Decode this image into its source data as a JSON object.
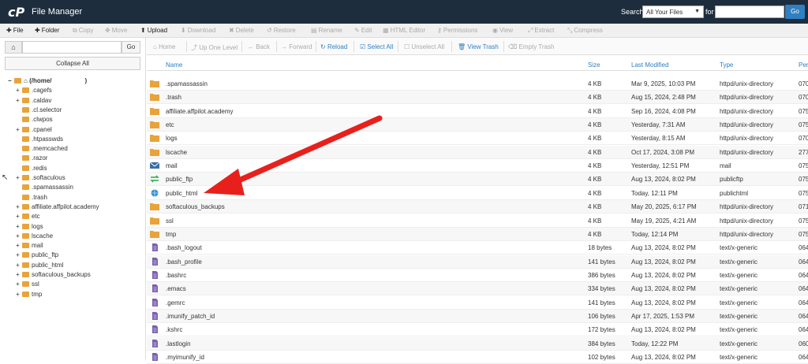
{
  "header": {
    "logo": "cP",
    "title": "File Manager",
    "search_label": "Search",
    "search_scope": "All Your Files",
    "for_label": "for",
    "go_label": "Go"
  },
  "toolbar": {
    "file": "File",
    "folder": "Folder",
    "copy": "Copy",
    "move": "Move",
    "upload": "Upload",
    "download": "Download",
    "delete": "Delete",
    "restore": "Restore",
    "rename": "Rename",
    "edit": "Edit",
    "html_editor": "HTML Editor",
    "permissions": "Permissions",
    "view": "View",
    "extract": "Extract",
    "compress": "Compress"
  },
  "left": {
    "go_label": "Go",
    "collapse_all": "Collapse All",
    "tree": [
      {
        "label": "(/home/",
        "suffix": ")",
        "pm": "−",
        "level": 0,
        "root": true
      },
      {
        "label": ".cagefs",
        "pm": "+",
        "level": 1
      },
      {
        "label": ".caldav",
        "pm": "+",
        "level": 1
      },
      {
        "label": ".cl.selector",
        "pm": "",
        "level": 1
      },
      {
        "label": ".clwpos",
        "pm": "",
        "level": 1
      },
      {
        "label": ".cpanel",
        "pm": "+",
        "level": 1
      },
      {
        "label": ".htpasswds",
        "pm": "",
        "level": 1
      },
      {
        "label": ".memcached",
        "pm": "",
        "level": 1
      },
      {
        "label": ".razor",
        "pm": "",
        "level": 1
      },
      {
        "label": ".redis",
        "pm": "",
        "level": 1
      },
      {
        "label": ".softaculous",
        "pm": "+",
        "level": 1
      },
      {
        "label": ".spamassassin",
        "pm": "",
        "level": 1
      },
      {
        "label": ".trash",
        "pm": "",
        "level": 1
      },
      {
        "label": "affiliate.affpilot.academy",
        "pm": "+",
        "level": 1
      },
      {
        "label": "etc",
        "pm": "+",
        "level": 1
      },
      {
        "label": "logs",
        "pm": "+",
        "level": 1
      },
      {
        "label": "lscache",
        "pm": "+",
        "level": 1
      },
      {
        "label": "mail",
        "pm": "+",
        "level": 1
      },
      {
        "label": "public_ftp",
        "pm": "+",
        "level": 1
      },
      {
        "label": "public_html",
        "pm": "+",
        "level": 1
      },
      {
        "label": "softaculous_backups",
        "pm": "+",
        "level": 1
      },
      {
        "label": "ssl",
        "pm": "+",
        "level": 1
      },
      {
        "label": "tmp",
        "pm": "+",
        "level": 1
      }
    ]
  },
  "right_toolbar": {
    "home": "Home",
    "up_one_level": "Up One Level",
    "back": "Back",
    "forward": "Forward",
    "reload": "Reload",
    "select_all": "Select All",
    "unselect_all": "Unselect All",
    "view_trash": "View Trash",
    "empty_trash": "Empty Trash"
  },
  "table": {
    "columns": {
      "name": "Name",
      "size": "Size",
      "modified": "Last Modified",
      "type": "Type",
      "perms": "Per"
    },
    "rows": [
      {
        "icon": "folder",
        "name": ".spamassassin",
        "size": "4 KB",
        "modified": "Mar 9, 2025, 10:03 PM",
        "type": "httpd/unix-directory",
        "perms": "070"
      },
      {
        "icon": "folder",
        "name": ".trash",
        "size": "4 KB",
        "modified": "Aug 15, 2024, 2:48 PM",
        "type": "httpd/unix-directory",
        "perms": "070"
      },
      {
        "icon": "folder",
        "name": "affiliate.affpilot.academy",
        "size": "4 KB",
        "modified": "Sep 16, 2024, 4:08 PM",
        "type": "httpd/unix-directory",
        "perms": "075"
      },
      {
        "icon": "folder",
        "name": "etc",
        "size": "4 KB",
        "modified": "Yesterday, 7:31 AM",
        "type": "httpd/unix-directory",
        "perms": "075"
      },
      {
        "icon": "folder",
        "name": "logs",
        "size": "4 KB",
        "modified": "Yesterday, 8:15 AM",
        "type": "httpd/unix-directory",
        "perms": "070"
      },
      {
        "icon": "folder",
        "name": "lscache",
        "size": "4 KB",
        "modified": "Oct 17, 2024, 3:08 PM",
        "type": "httpd/unix-directory",
        "perms": "277"
      },
      {
        "icon": "mail",
        "name": "mail",
        "size": "4 KB",
        "modified": "Yesterday, 12:51 PM",
        "type": "mail",
        "perms": "075"
      },
      {
        "icon": "ftp",
        "name": "public_ftp",
        "size": "4 KB",
        "modified": "Aug 13, 2024, 8:02 PM",
        "type": "publicftp",
        "perms": "075"
      },
      {
        "icon": "globe",
        "name": "public_html",
        "size": "4 KB",
        "modified": "Today, 12:11 PM",
        "type": "publichtml",
        "perms": "075"
      },
      {
        "icon": "folder",
        "name": "softaculous_backups",
        "size": "4 KB",
        "modified": "May 20, 2025, 6:17 PM",
        "type": "httpd/unix-directory",
        "perms": "071"
      },
      {
        "icon": "folder",
        "name": "ssl",
        "size": "4 KB",
        "modified": "May 19, 2025, 4:21 AM",
        "type": "httpd/unix-directory",
        "perms": "075"
      },
      {
        "icon": "folder",
        "name": "tmp",
        "size": "4 KB",
        "modified": "Today, 12:14 PM",
        "type": "httpd/unix-directory",
        "perms": "075"
      },
      {
        "icon": "file",
        "name": ".bash_logout",
        "size": "18 bytes",
        "modified": "Aug 13, 2024, 8:02 PM",
        "type": "text/x-generic",
        "perms": "064"
      },
      {
        "icon": "file",
        "name": ".bash_profile",
        "size": "141 bytes",
        "modified": "Aug 13, 2024, 8:02 PM",
        "type": "text/x-generic",
        "perms": "064"
      },
      {
        "icon": "file",
        "name": ".bashrc",
        "size": "386 bytes",
        "modified": "Aug 13, 2024, 8:02 PM",
        "type": "text/x-generic",
        "perms": "064"
      },
      {
        "icon": "file",
        "name": ".emacs",
        "size": "334 bytes",
        "modified": "Aug 13, 2024, 8:02 PM",
        "type": "text/x-generic",
        "perms": "064"
      },
      {
        "icon": "file",
        "name": ".gemrc",
        "size": "141 bytes",
        "modified": "Aug 13, 2024, 8:02 PM",
        "type": "text/x-generic",
        "perms": "064"
      },
      {
        "icon": "file",
        "name": ".imunify_patch_id",
        "size": "106 bytes",
        "modified": "Apr 17, 2025, 1:53 PM",
        "type": "text/x-generic",
        "perms": "064"
      },
      {
        "icon": "file",
        "name": ".kshrc",
        "size": "172 bytes",
        "modified": "Aug 13, 2024, 8:02 PM",
        "type": "text/x-generic",
        "perms": "064"
      },
      {
        "icon": "file",
        "name": ".lastlogin",
        "size": "384 bytes",
        "modified": "Today, 12:22 PM",
        "type": "text/x-generic",
        "perms": "060"
      },
      {
        "icon": "file",
        "name": ".myimunify_id",
        "size": "102 bytes",
        "modified": "Aug 13, 2024, 8:02 PM",
        "type": "text/x-generic",
        "perms": "064"
      }
    ]
  },
  "colors": {
    "header_bg": "#1d2d3d",
    "link_blue": "#2f7fc1",
    "folder": "#e8a33a",
    "arrow_red": "#e8201c"
  }
}
